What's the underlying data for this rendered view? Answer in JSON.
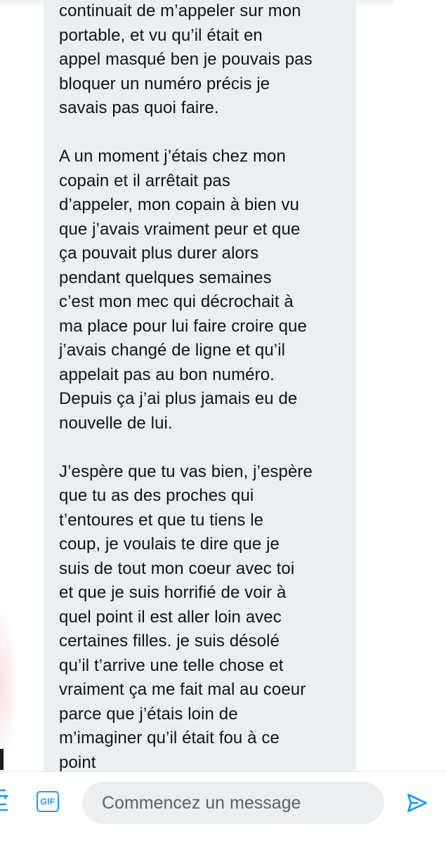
{
  "conversation": {
    "message_text": "continuait de m’appeler sur mon\nportable, et vu qu’il était en\nappel masqué ben je pouvais pas\nbloquer un numéro précis je\nsavais pas quoi faire.\n\nA un moment j’étais chez mon\ncopain et il arrêtait pas\nd’appeler, mon copain à bien vu\nque j’avais vraiment peur et que\nça pouvait plus durer alors\npendant quelques semaines\nc’est mon mec qui décrochait à\nma place pour lui faire croire que\nj’avais changé de ligne et qu’il\nappelait pas au bon numéro.\nDepuis ça j’ai plus jamais eu de\nnouvelle de lui.\n\nJ’espère que tu vas bien, j’espère\nque tu as des proches qui\nt’entoures et que tu tiens le\ncoup, je voulais te dire que je\nsuis de tout mon coeur avec toi\net que je suis horrifié de voir à\nquel point il est aller loin avec\ncertaines filles. je suis désolé\nqu’il t’arrive une telle chose et\nvraiment ça me fait mal au coeur\nparce que j’étais loin de\nm’imaginer qu’il était fou à ce\npoint"
  },
  "composer": {
    "gif_label": "GIF",
    "placeholder": "Commencez un message",
    "value": "",
    "gif_icon": "gif-icon",
    "send_icon": "paper-plane-icon"
  },
  "colors": {
    "accent": "#1d9bf0",
    "bubble_background": "#eceff1",
    "text": "#0f1419",
    "placeholder": "#536471"
  }
}
